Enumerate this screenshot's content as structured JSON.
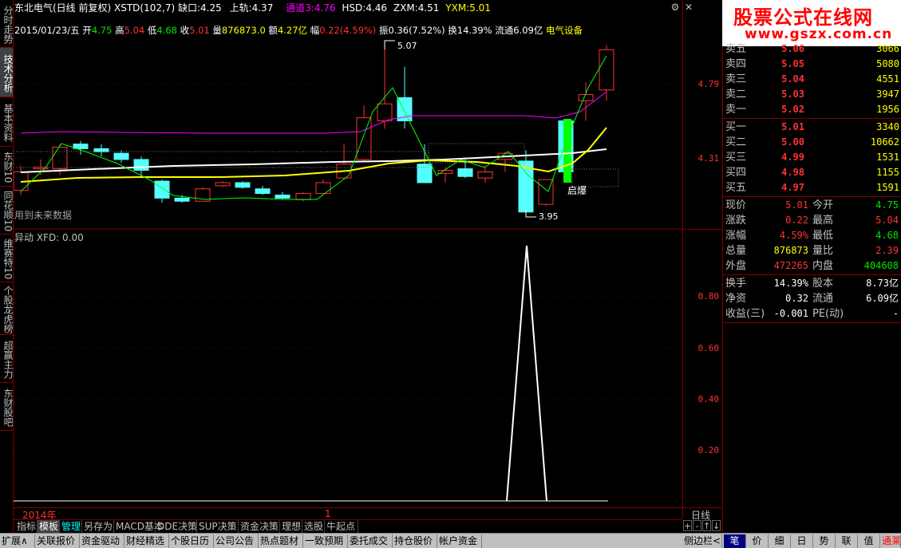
{
  "left_tabs": [
    "分时走势",
    "技术分析",
    "基本资料",
    "东财10",
    "同花顺10",
    "维赛特10",
    "个股龙虎榜",
    "超赢主力",
    "东财股吧"
  ],
  "header": {
    "stock_name": "东北电气(日线 前复权)",
    "indicator": "XSTD(102,7)",
    "gap_down_label": "缺口:",
    "gap_down_value": "4.25",
    "upper_label": "上轨:",
    "upper_value": "4.37",
    "channel_label": "通道3:",
    "channel_value": "4.76",
    "hsd_label": "HSD:",
    "hsd_value": "4.46",
    "zxm_label": "ZXM:",
    "zxm_value": "4.51",
    "yxm_label": "YXM:",
    "yxm_value": "5.01"
  },
  "info_line": {
    "date": "2015/01/23/五",
    "open_label": "开",
    "open": "4.75",
    "high_label": "高",
    "high": "5.04",
    "low_label": "低",
    "low": "4.68",
    "close_label": "收",
    "close": "5.01",
    "vol_label": "量",
    "vol": "876873.0",
    "amount_label": "额",
    "amount": "4.27亿",
    "chg_label": "幅",
    "chg": "0.22(4.59%)",
    "amp_label": "振",
    "amp": "0.36(7.52%)",
    "turnover_label": "换",
    "turnover": "14.39%",
    "float_label": "流通",
    "float": "6.09亿",
    "industry": "电气设备"
  },
  "chart_labels": {
    "future_data": "用到未来数据",
    "high_mark": "5.07",
    "low_mark": "3.95",
    "signal": "启爆"
  },
  "sub_title": "异动  XFD: 0.00",
  "right_axis": {
    "main_ticks": [
      "4.79",
      "4.31"
    ],
    "sub_ticks": [
      "0.80",
      "0.60",
      "0.40",
      "0.20"
    ]
  },
  "time_axis": {
    "year": "2014年",
    "month": "1",
    "period": "日线"
  },
  "nav_buttons": [
    "+",
    "-",
    "↑",
    "↓"
  ],
  "bottom_tabs": [
    "指标",
    "模板",
    "管理",
    "另存为",
    "MACD基本",
    "DDE决策",
    "SUP决策",
    "资金决策",
    "理想",
    "选股",
    "牛起点"
  ],
  "status_bar": [
    "扩展∧",
    "关联报价",
    "资金驱动",
    "财经精选",
    "个股日历",
    "公司公告",
    "热点题材",
    "一致预期",
    "委托成交",
    "持仓股价",
    "帐户资金"
  ],
  "status_right": {
    "sidebar": "侧边栏<",
    "buttons": [
      "笔",
      "价",
      "细",
      "日",
      "势",
      "联",
      "值"
    ],
    "last": "通莱"
  },
  "watermark": {
    "title": "股票公式在线网",
    "url": "www.gszx.com.cn"
  },
  "order_book": {
    "asks": [
      {
        "label": "卖五",
        "price": "5.06",
        "volume": "3066"
      },
      {
        "label": "卖四",
        "price": "5.05",
        "volume": "5080"
      },
      {
        "label": "卖三",
        "price": "5.04",
        "volume": "4551"
      },
      {
        "label": "卖二",
        "price": "5.03",
        "volume": "3947"
      },
      {
        "label": "卖一",
        "price": "5.02",
        "volume": "1956"
      }
    ],
    "bids": [
      {
        "label": "买一",
        "price": "5.01",
        "volume": "3340"
      },
      {
        "label": "买二",
        "price": "5.00",
        "volume": "10662"
      },
      {
        "label": "买三",
        "price": "4.99",
        "volume": "1531"
      },
      {
        "label": "买四",
        "price": "4.98",
        "volume": "1155"
      },
      {
        "label": "买五",
        "price": "4.97",
        "volume": "1591"
      }
    ]
  },
  "quote": {
    "rows": [
      {
        "k1": "现价",
        "v1": "5.01",
        "c1": "red",
        "k2": "今开",
        "v2": "4.75",
        "c2": "green"
      },
      {
        "k1": "涨跌",
        "v1": "0.22",
        "c1": "red",
        "k2": "最高",
        "v2": "5.04",
        "c2": "red"
      },
      {
        "k1": "涨幅",
        "v1": "4.59%",
        "c1": "red",
        "k2": "最低",
        "v2": "4.68",
        "c2": "green"
      },
      {
        "k1": "总量",
        "v1": "876873",
        "c1": "yellow",
        "k2": "量比",
        "v2": "2.39",
        "c2": "red"
      },
      {
        "k1": "外盘",
        "v1": "472265",
        "c1": "red",
        "k2": "内盘",
        "v2": "404608",
        "c2": "green"
      }
    ],
    "rows2": [
      {
        "k1": "换手",
        "v1": "14.39%",
        "k2": "股本",
        "v2": "8.73亿"
      },
      {
        "k1": "净资",
        "v1": "0.32",
        "k2": "流通",
        "v2": "6.09亿"
      },
      {
        "k1": "收益(三)",
        "v1": "-0.001",
        "k2": "PE(动)",
        "v2": "-"
      }
    ]
  },
  "colors": {
    "up": "#ff3232",
    "down": "#54ffff",
    "frame": "#800000",
    "ma_white": "#ffffff",
    "ma_yellow": "#ffff00",
    "ma_purple": "#ff00ff",
    "ma_green": "#00ff00"
  }
}
